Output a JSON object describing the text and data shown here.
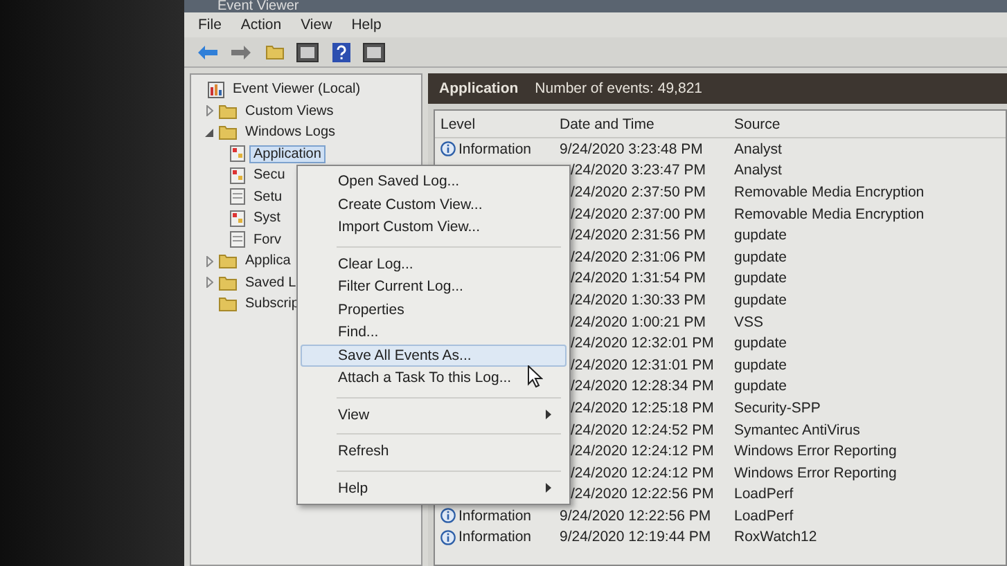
{
  "window": {
    "title": "Event Viewer"
  },
  "menu_bar": [
    "File",
    "Action",
    "View",
    "Help"
  ],
  "tree": [
    {
      "label": "Event Viewer (Local)",
      "selected": false,
      "children": [
        {
          "label": "Custom Views",
          "expanded": false,
          "selected": false
        },
        {
          "label": "Windows Logs",
          "expanded": true,
          "selected": false,
          "children": [
            {
              "label": "Application",
              "selected": true
            },
            {
              "label": "Secu",
              "selected": false
            },
            {
              "label": "Setu",
              "selected": false
            },
            {
              "label": "Syst",
              "selected": false
            },
            {
              "label": "Forv",
              "selected": false
            }
          ]
        },
        {
          "label": "Applica",
          "expanded": false,
          "selected": false
        },
        {
          "label": "Saved L",
          "expanded": false,
          "selected": false
        },
        {
          "label": "Subscrip",
          "selected": false
        }
      ]
    }
  ],
  "log_header": {
    "title": "Application",
    "count": "Number of events: 49,821"
  },
  "table": {
    "columns": [
      "Level",
      "Date and Time",
      "Source"
    ],
    "rows": [
      {
        "level": "Information",
        "date": "9/24/2020 3:23:48 PM",
        "source": "Analyst"
      },
      {
        "date": "/24/2020 3:23:47 PM",
        "source": "Analyst"
      },
      {
        "date": "/24/2020 2:37:50 PM",
        "source": "Removable Media Encryption"
      },
      {
        "date": "/24/2020 2:37:00 PM",
        "source": "Removable Media Encryption"
      },
      {
        "date": "/24/2020 2:31:56 PM",
        "source": "gupdate"
      },
      {
        "date": "/24/2020 2:31:06 PM",
        "source": "gupdate"
      },
      {
        "date": "/24/2020 1:31:54 PM",
        "source": "gupdate"
      },
      {
        "date": "/24/2020 1:30:33 PM",
        "source": "gupdate"
      },
      {
        "date": "/24/2020 1:00:21 PM",
        "source": "VSS"
      },
      {
        "date": "/24/2020 12:32:01 PM",
        "source": "gupdate"
      },
      {
        "date": "/24/2020 12:31:01 PM",
        "source": "gupdate"
      },
      {
        "date": "/24/2020 12:28:34 PM",
        "source": "gupdate"
      },
      {
        "date": "/24/2020 12:25:18 PM",
        "source": "Security-SPP"
      },
      {
        "date": "/24/2020 12:24:52 PM",
        "source": "Symantec AntiVirus"
      },
      {
        "date": "/24/2020 12:24:12 PM",
        "source": "Windows Error Reporting"
      },
      {
        "date": "/24/2020 12:24:12 PM",
        "source": "Windows Error Reporting"
      },
      {
        "date": "/24/2020 12:22:56 PM",
        "source": "LoadPerf"
      },
      {
        "level": "Information",
        "date": "9/24/2020 12:22:56 PM",
        "source": "LoadPerf"
      },
      {
        "level": "Information",
        "date": "9/24/2020 12:19:44 PM",
        "source": "RoxWatch12"
      }
    ]
  },
  "context_menu": [
    {
      "kind": "item",
      "label": "Open Saved Log...",
      "highlighted": false,
      "submenu": false
    },
    {
      "kind": "item",
      "label": "Create Custom View...",
      "highlighted": false,
      "submenu": false
    },
    {
      "kind": "item",
      "label": "Import Custom View...",
      "highlighted": false,
      "submenu": false
    },
    {
      "kind": "separator"
    },
    {
      "kind": "item",
      "label": "Clear Log...",
      "highlighted": false,
      "submenu": false
    },
    {
      "kind": "item",
      "label": "Filter Current Log...",
      "highlighted": false,
      "submenu": false
    },
    {
      "kind": "item",
      "label": "Properties",
      "highlighted": false,
      "submenu": false
    },
    {
      "kind": "item",
      "label": "Find...",
      "highlighted": false,
      "submenu": false
    },
    {
      "kind": "item",
      "label": "Save All Events As...",
      "highlighted": true,
      "submenu": false
    },
    {
      "kind": "item",
      "label": "Attach a Task To this Log...",
      "highlighted": false,
      "submenu": false
    },
    {
      "kind": "separator"
    },
    {
      "kind": "item",
      "label": "View",
      "highlighted": false,
      "submenu": true
    },
    {
      "kind": "separator"
    },
    {
      "kind": "item",
      "label": "Refresh",
      "highlighted": false,
      "submenu": false
    },
    {
      "kind": "separator"
    },
    {
      "kind": "item",
      "label": "Help",
      "highlighted": false,
      "submenu": true
    }
  ]
}
